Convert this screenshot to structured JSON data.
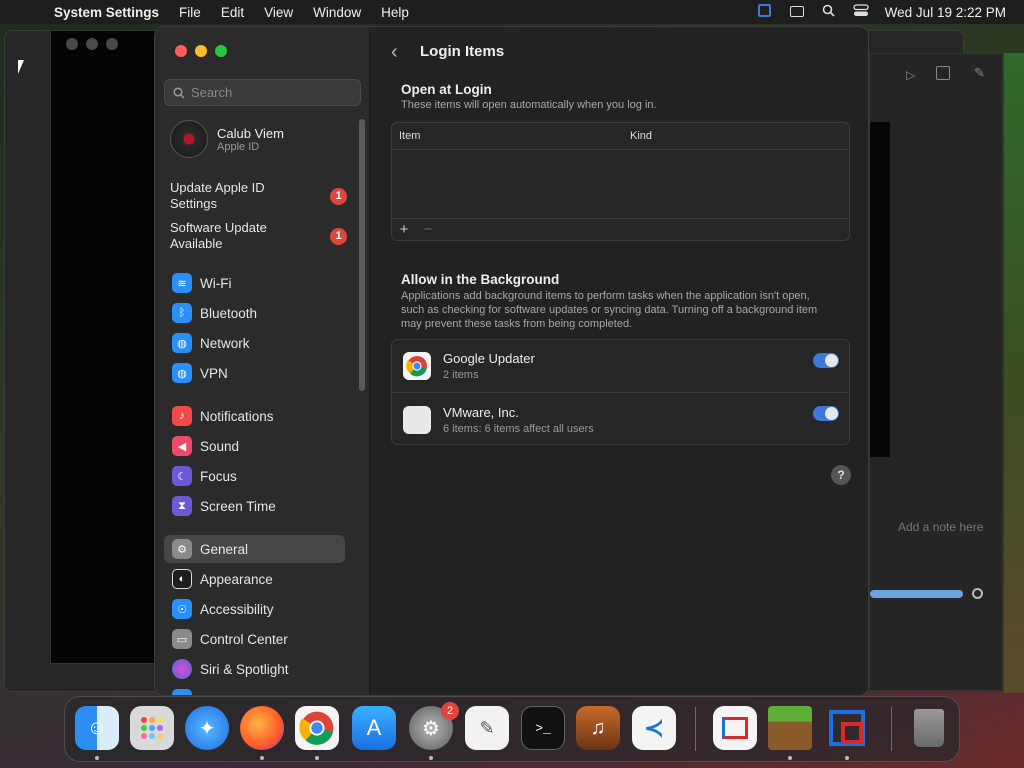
{
  "menubar": {
    "app_name": "System Settings",
    "items": [
      "File",
      "Edit",
      "View",
      "Window",
      "Help"
    ],
    "clock": "Wed Jul 19  2:22 PM"
  },
  "sidebar": {
    "search_placeholder": "Search",
    "profile": {
      "name": "Calub Viem",
      "subtitle": "Apple ID"
    },
    "alerts": [
      {
        "label_line1": "Update Apple ID",
        "label_line2": "Settings",
        "badge": "1"
      },
      {
        "label_line1": "Software Update",
        "label_line2": "Available",
        "badge": "1"
      }
    ],
    "items": [
      {
        "label": "Wi-Fi",
        "icon": "wifi-icon",
        "color": "#2a8ff7"
      },
      {
        "label": "Bluetooth",
        "icon": "bluetooth-icon",
        "color": "#2a8ff7"
      },
      {
        "label": "Network",
        "icon": "globe-icon",
        "color": "#2a8ff7"
      },
      {
        "label": "VPN",
        "icon": "globe-icon",
        "color": "#2a8ff7"
      },
      {
        "label": "Notifications",
        "icon": "bell-icon",
        "color": "#f04a4a"
      },
      {
        "label": "Sound",
        "icon": "speaker-icon",
        "color": "#f04a6a"
      },
      {
        "label": "Focus",
        "icon": "moon-icon",
        "color": "#6b5ad6"
      },
      {
        "label": "Screen Time",
        "icon": "hourglass-icon",
        "color": "#6b5ad6"
      },
      {
        "label": "General",
        "icon": "gear-icon",
        "color": "#8a8a8a"
      },
      {
        "label": "Appearance",
        "icon": "appearance-icon",
        "color": "#1e1e1e"
      },
      {
        "label": "Accessibility",
        "icon": "accessibility-icon",
        "color": "#2a8ff7"
      },
      {
        "label": "Control Center",
        "icon": "control-center-icon",
        "color": "#8a8a8a"
      },
      {
        "label": "Siri & Spotlight",
        "icon": "siri-icon",
        "color": "#b44ad6"
      }
    ],
    "selected": "General"
  },
  "main": {
    "title": "Login Items",
    "open_at_login": {
      "heading": "Open at Login",
      "subtitle": "These items will open automatically when you log in.",
      "columns": [
        "Item",
        "Kind"
      ],
      "add_label": "+",
      "remove_label": "−"
    },
    "background": {
      "heading": "Allow in the Background",
      "subtitle": "Applications add background items to perform tasks when the application isn't open, such as checking for software updates or syncing data. Turning off a background item may prevent these tasks from being completed.",
      "items": [
        {
          "title": "Google Updater",
          "subtitle": "2 items",
          "enabled": true
        },
        {
          "title": "VMware, Inc.",
          "subtitle": "6 items: 6 items affect all users",
          "enabled": true
        }
      ]
    },
    "help_label": "?"
  },
  "background_window": {
    "note_placeholder": "Add a note here"
  },
  "dock": {
    "apps": [
      "Finder",
      "Launchpad",
      "Safari",
      "Firefox",
      "Chrome",
      "App Store",
      "System Settings",
      "TextEdit",
      "Terminal",
      "GarageBand",
      "Visual Studio Code",
      "Parallels",
      "Minecraft",
      "VMware Fusion",
      "Trash"
    ],
    "settings_badge": "2"
  }
}
